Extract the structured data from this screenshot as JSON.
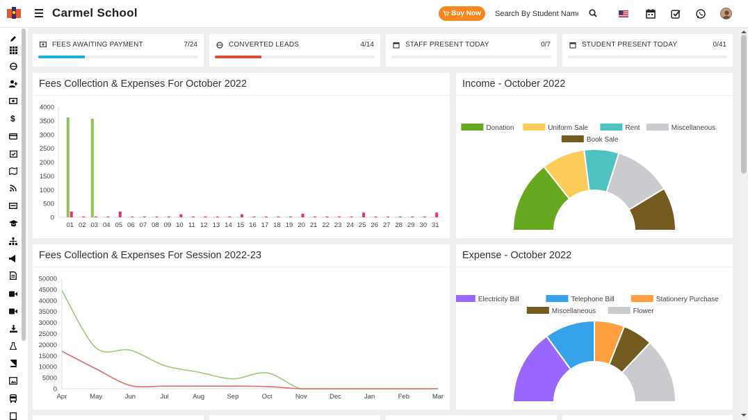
{
  "header": {
    "title": "Carmel School",
    "buy_label": "Buy Now",
    "search_placeholder": "Search By Student Name"
  },
  "stats": [
    {
      "label": "FEES AWAITING PAYMENT",
      "value": "7/24",
      "progress": 0.29,
      "color": "#16b3de"
    },
    {
      "label": "CONVERTED LEADS",
      "value": "4/14",
      "progress": 0.29,
      "color": "#dd4b39"
    },
    {
      "label": "STAFF PRESENT TODAY",
      "value": "0/7",
      "progress": 0,
      "color": "#00a65a"
    },
    {
      "label": "STUDENT PRESENT TODAY",
      "value": "0/41",
      "progress": 0,
      "color": "#00a65a"
    }
  ],
  "panels": {
    "monthly_title": "Fees Collection & Expenses For October 2022",
    "income_title": "Income - October 2022",
    "session_title": "Fees Collection & Expenses For Session 2022-23",
    "expense_title": "Expense - October 2022"
  },
  "colors": {
    "fees": "#8dc457",
    "expense": "#e8336f",
    "accent": "#f7861c"
  },
  "chart_data": [
    {
      "type": "bar",
      "categories": [
        "01",
        "02",
        "03",
        "04",
        "05",
        "06",
        "07",
        "08",
        "09",
        "10",
        "11",
        "12",
        "13",
        "14",
        "15",
        "16",
        "17",
        "18",
        "19",
        "20",
        "21",
        "22",
        "23",
        "24",
        "25",
        "26",
        "27",
        "28",
        "29",
        "30",
        "31"
      ],
      "series": [
        {
          "values": [
            3620,
            10,
            3570,
            10,
            10,
            10,
            10,
            10,
            10,
            10,
            10,
            10,
            10,
            10,
            10,
            10,
            10,
            10,
            10,
            10,
            10,
            10,
            10,
            10,
            10,
            10,
            10,
            10,
            10,
            10,
            10
          ],
          "color": "#8dc457"
        },
        {
          "values": [
            210,
            30,
            30,
            30,
            210,
            30,
            30,
            30,
            30,
            110,
            30,
            30,
            30,
            30,
            110,
            30,
            30,
            30,
            30,
            130,
            30,
            30,
            30,
            30,
            170,
            30,
            30,
            30,
            30,
            30,
            170
          ],
          "color": "#e8336f"
        }
      ],
      "ylim": [
        0,
        4000
      ],
      "yticks": [
        0,
        500,
        1000,
        1500,
        2000,
        2500,
        3000,
        3500,
        4000
      ]
    },
    {
      "type": "pie",
      "labels": [
        "Donation",
        "Uniform Sale",
        "Rent",
        "Miscellaneous",
        "Book Sale"
      ],
      "values": [
        25,
        15,
        12,
        20,
        15
      ],
      "colors": [
        "#66a81f",
        "#fdcb57",
        "#4ec1c1",
        "#c9cbcf",
        "#735a1f"
      ]
    },
    {
      "type": "line",
      "x": [
        "Apr",
        "May",
        "Jun",
        "Jul",
        "Aug",
        "Sep",
        "Oct",
        "Nov",
        "Dec",
        "Jan",
        "Feb",
        "Mar"
      ],
      "series": [
        {
          "values": [
            44500,
            18500,
            17500,
            10500,
            7500,
            4500,
            7200,
            0,
            0,
            0,
            0,
            0
          ],
          "color": "#9ccb72"
        },
        {
          "values": [
            17000,
            9000,
            1500,
            1200,
            1200,
            1200,
            1000,
            0,
            0,
            0,
            0,
            0
          ],
          "color": "#e36a6a"
        }
      ],
      "ylim": [
        0,
        50000
      ],
      "yticks": [
        0,
        5000,
        10000,
        15000,
        20000,
        25000,
        30000,
        35000,
        40000,
        45000,
        50000
      ]
    },
    {
      "type": "pie",
      "labels": [
        "Electricity Bill",
        "Telephone Bill",
        "Stationery Purchase",
        "Miscellaneous",
        "Flower"
      ],
      "values": [
        30,
        20,
        12,
        12,
        26
      ],
      "colors": [
        "#9966ff",
        "#36a2eb",
        "#ff9f40",
        "#735a1f",
        "#c9cbcf"
      ]
    }
  ]
}
